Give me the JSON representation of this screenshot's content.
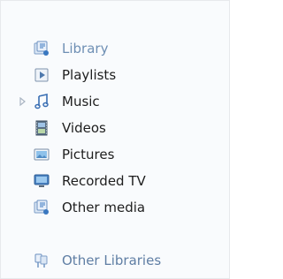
{
  "nav": {
    "library": {
      "label": "Library",
      "icon": "library-icon"
    },
    "items": [
      {
        "label": "Playlists",
        "icon": "playlist-icon",
        "expandable": false
      },
      {
        "label": "Music",
        "icon": "music-note-icon",
        "expandable": true
      },
      {
        "label": "Videos",
        "icon": "video-icon",
        "expandable": false
      },
      {
        "label": "Pictures",
        "icon": "picture-icon",
        "expandable": false
      },
      {
        "label": "Recorded TV",
        "icon": "tv-icon",
        "expandable": false
      },
      {
        "label": "Other media",
        "icon": "other-media-icon",
        "expandable": false
      }
    ],
    "other_libraries": {
      "label": "Other Libraries",
      "icon": "other-libraries-icon"
    }
  },
  "colors": {
    "background": "#f9fbfd",
    "text": "#1e1e1e",
    "header_text": "#6e8fb4",
    "icon_blue": "#3a78c0"
  }
}
